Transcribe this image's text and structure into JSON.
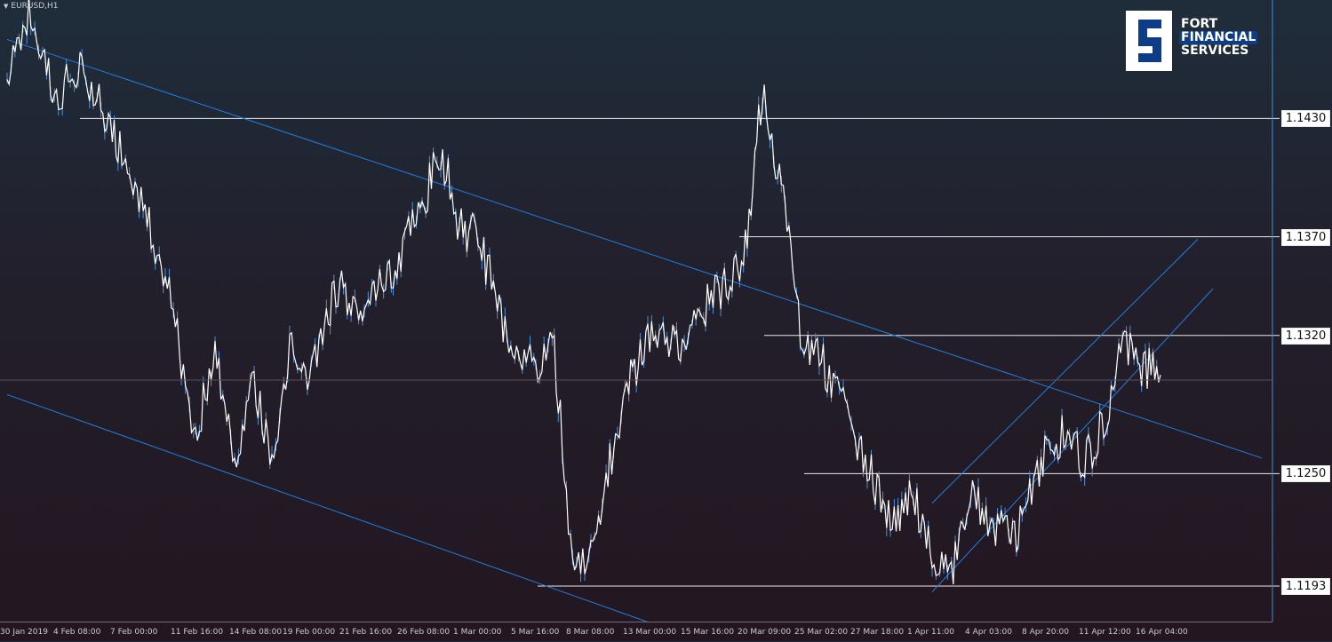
{
  "symbol": {
    "label": "EURUSD,H1"
  },
  "logo": {
    "line1": "FORT",
    "line2": "FINANCIAL",
    "line3": "SERVICES"
  },
  "colors": {
    "candle": "#ffffff",
    "candle_shadow": "#4a90e2",
    "trendline": "#1f7fe0",
    "level": "#e8e8e8",
    "cursor": "#3d8fd6"
  },
  "chart_data": {
    "type": "line",
    "symbol": "EURUSD",
    "timeframe": "H1",
    "y_range": [
      1.1175,
      1.149
    ],
    "horizontal_levels": [
      {
        "label": "1.1430",
        "value": 1.143
      },
      {
        "label": "1.1370",
        "value": 1.137
      },
      {
        "label": "1.1320",
        "value": 1.132
      },
      {
        "label": "1.1250",
        "value": 1.125
      },
      {
        "label": "1.1193",
        "value": 1.1193
      }
    ],
    "x_tick_labels": [
      "30 Jan 2019",
      "4 Feb 08:00",
      "7 Feb 00:00",
      "11 Feb 16:00",
      "14 Feb 08:00",
      "19 Feb 00:00",
      "21 Feb 16:00",
      "26 Feb 08:00",
      "1 Mar 00:00",
      "5 Mar 16:00",
      "8 Mar 08:00",
      "13 Mar 00:00",
      "15 Mar 16:00",
      "20 Mar 09:00",
      "25 Mar 02:00",
      "27 Mar 18:00",
      "1 Apr 11:00",
      "4 Apr 03:00",
      "8 Apr 20:00",
      "11 Apr 12:00",
      "16 Apr 04:00"
    ],
    "price_path": [
      {
        "t": "30 Jan 2019",
        "v": 1.145
      },
      {
        "t": "31 Jan",
        "v": 1.1485
      },
      {
        "t": "1 Feb",
        "v": 1.144
      },
      {
        "t": "4 Feb 08:00",
        "v": 1.1455
      },
      {
        "t": "5 Feb",
        "v": 1.143
      },
      {
        "t": "7 Feb 00:00",
        "v": 1.14
      },
      {
        "t": "8 Feb",
        "v": 1.135
      },
      {
        "t": "11 Feb 16:00",
        "v": 1.127
      },
      {
        "t": "12 Feb",
        "v": 1.131
      },
      {
        "t": "13 Feb",
        "v": 1.126
      },
      {
        "t": "14 Feb 08:00",
        "v": 1.1295
      },
      {
        "t": "15 Feb",
        "v": 1.1255
      },
      {
        "t": "18 Feb",
        "v": 1.1315
      },
      {
        "t": "19 Feb 00:00",
        "v": 1.13
      },
      {
        "t": "20 Feb",
        "v": 1.1345
      },
      {
        "t": "21 Feb 16:00",
        "v": 1.1335
      },
      {
        "t": "22 Feb",
        "v": 1.1355
      },
      {
        "t": "26 Feb 08:00",
        "v": 1.1385
      },
      {
        "t": "27 Feb",
        "v": 1.1415
      },
      {
        "t": "28 Feb",
        "v": 1.1375
      },
      {
        "t": "1 Mar 00:00",
        "v": 1.137
      },
      {
        "t": "4 Mar",
        "v": 1.132
      },
      {
        "t": "5 Mar 16:00",
        "v": 1.1305
      },
      {
        "t": "6 Mar",
        "v": 1.1315
      },
      {
        "t": "7 Mar",
        "v": 1.12
      },
      {
        "t": "8 Mar 08:00",
        "v": 1.1215
      },
      {
        "t": "11 Mar",
        "v": 1.1255
      },
      {
        "t": "12 Mar",
        "v": 1.1295
      },
      {
        "t": "13 Mar 00:00",
        "v": 1.132
      },
      {
        "t": "14 Mar",
        "v": 1.1315
      },
      {
        "t": "15 Mar 16:00",
        "v": 1.1335
      },
      {
        "t": "18 Mar",
        "v": 1.1345
      },
      {
        "t": "19 Mar",
        "v": 1.1355
      },
      {
        "t": "20 Mar 09:00",
        "v": 1.1445
      },
      {
        "t": "21 Mar",
        "v": 1.1395
      },
      {
        "t": "22 Mar",
        "v": 1.132
      },
      {
        "t": "25 Mar 02:00",
        "v": 1.131
      },
      {
        "t": "26 Mar",
        "v": 1.128
      },
      {
        "t": "27 Mar 18:00",
        "v": 1.1245
      },
      {
        "t": "28 Mar",
        "v": 1.1225
      },
      {
        "t": "29 Mar",
        "v": 1.124
      },
      {
        "t": "1 Apr 11:00",
        "v": 1.121
      },
      {
        "t": "2 Apr",
        "v": 1.1195
      },
      {
        "t": "3 Apr",
        "v": 1.1245
      },
      {
        "t": "4 Apr 03:00",
        "v": 1.1225
      },
      {
        "t": "5 Apr",
        "v": 1.122
      },
      {
        "t": "8 Apr 20:00",
        "v": 1.1265
      },
      {
        "t": "9 Apr",
        "v": 1.127
      },
      {
        "t": "10 Apr",
        "v": 1.1255
      },
      {
        "t": "11 Apr 12:00",
        "v": 1.1275
      },
      {
        "t": "12 Apr",
        "v": 1.132
      },
      {
        "t": "15 Apr",
        "v": 1.1305
      },
      {
        "t": "16 Apr 04:00",
        "v": 1.13
      }
    ],
    "trendlines": [
      {
        "name": "falling-channel-upper",
        "from": {
          "t": "30 Jan 2019",
          "v": 1.147
        },
        "to": {
          "t": "16 Apr 04:00",
          "v": 1.1275
        }
      },
      {
        "name": "falling-channel-lower",
        "from": {
          "t": "30 Jan 2019",
          "v": 1.129
        },
        "to": {
          "t": "8 Mar 08:00",
          "v": 1.1185
        }
      },
      {
        "name": "rising-channel-upper",
        "from": {
          "t": "1 Apr 11:00",
          "v": 1.1235
        },
        "to": {
          "t": "16 Apr 04:00",
          "v": 1.135
        }
      },
      {
        "name": "rising-channel-lower",
        "from": {
          "t": "1 Apr 11:00",
          "v": 1.119
        },
        "to": {
          "t": "16 Apr 04:00",
          "v": 1.1315
        }
      }
    ]
  }
}
